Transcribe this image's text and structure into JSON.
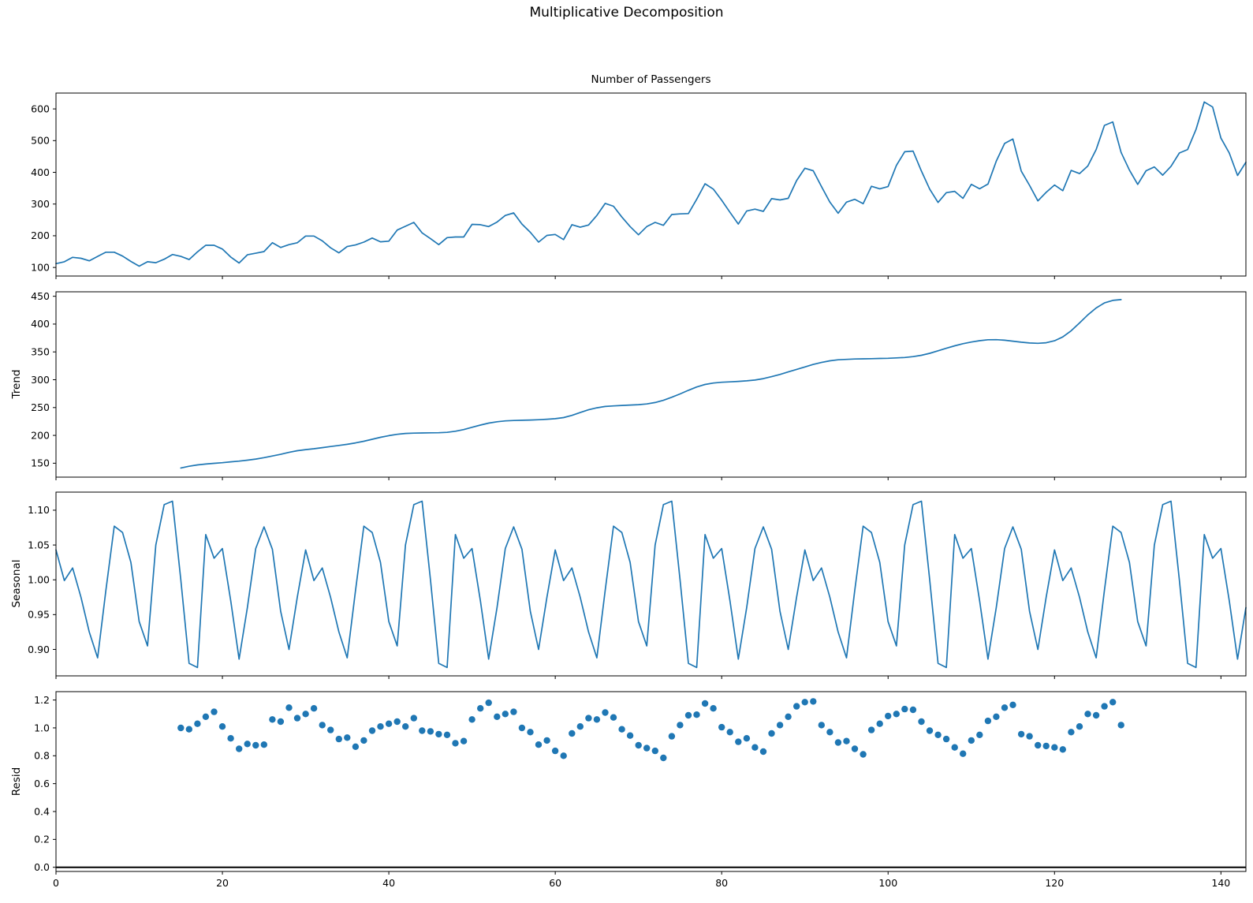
{
  "figure": {
    "suptitle": "Multiplicative Decomposition",
    "background": "#ffffff",
    "series_color": "#1f77b4",
    "axhline_color": "#000000",
    "spine_color": "#000000"
  },
  "chart_data": [
    {
      "type": "line",
      "title": "Number of Passengers",
      "ylabel": "",
      "xlim": [
        0,
        143
      ],
      "ylim": [
        73,
        650
      ],
      "yticks": [
        100,
        200,
        300,
        400,
        500,
        600
      ],
      "ytick_labels": [
        "100",
        "200",
        "300",
        "400",
        "500",
        "600"
      ],
      "x_start": 0,
      "values": [
        112,
        118,
        132,
        129,
        121,
        135,
        148,
        148,
        136,
        119,
        104,
        118,
        115,
        126,
        141,
        135,
        125,
        149,
        170,
        170,
        158,
        133,
        114,
        140,
        145,
        150,
        178,
        163,
        172,
        178,
        199,
        199,
        184,
        162,
        146,
        166,
        171,
        180,
        193,
        181,
        183,
        218,
        230,
        242,
        209,
        191,
        172,
        194,
        196,
        196,
        236,
        235,
        229,
        243,
        264,
        272,
        237,
        211,
        180,
        201,
        204,
        188,
        235,
        227,
        234,
        264,
        302,
        293,
        259,
        229,
        203,
        229,
        242,
        233,
        267,
        269,
        270,
        315,
        364,
        347,
        312,
        274,
        237,
        278,
        284,
        277,
        317,
        313,
        318,
        374,
        413,
        405,
        355,
        306,
        271,
        306,
        315,
        301,
        356,
        348,
        355,
        422,
        465,
        467,
        404,
        347,
        305,
        336,
        340,
        318,
        362,
        348,
        363,
        435,
        491,
        505,
        404,
        359,
        310,
        337,
        360,
        342,
        406,
        396,
        420,
        472,
        548,
        559,
        463,
        407,
        362,
        405,
        417,
        391,
        419,
        461,
        472,
        535,
        622,
        606,
        508,
        461,
        390,
        432
      ]
    },
    {
      "type": "line",
      "title": "",
      "ylabel": "Trend",
      "xlim": [
        0,
        143
      ],
      "ylim": [
        125,
        458
      ],
      "yticks": [
        150,
        200,
        250,
        300,
        350,
        400,
        450
      ],
      "ytick_labels": [
        "150",
        "200",
        "250",
        "300",
        "350",
        "400",
        "450"
      ],
      "x_start": 15,
      "values": [
        141.5,
        144.5,
        147,
        148.5,
        149.8,
        151,
        152.5,
        153.8,
        155.5,
        157.5,
        160,
        163,
        166,
        169.5,
        172.5,
        174.5,
        176,
        178,
        180,
        182,
        184,
        186.5,
        189.5,
        193,
        196.5,
        199.5,
        202,
        203.5,
        204,
        204.3,
        204.6,
        204.8,
        205.5,
        207.5,
        210.5,
        214.5,
        218.5,
        222,
        224.5,
        226,
        226.8,
        227.2,
        227.6,
        228.2,
        229,
        230,
        232,
        236,
        241,
        246,
        249.5,
        252,
        253,
        253.8,
        254.5,
        255.2,
        256.5,
        259,
        263,
        268.5,
        274.5,
        281,
        287,
        291.5,
        294,
        295.5,
        296.2,
        297,
        298,
        299.5,
        302,
        305.5,
        309.5,
        314,
        318.5,
        323,
        327.5,
        331,
        334,
        335.8,
        336.6,
        337.2,
        337.6,
        337.9,
        338.2,
        338.6,
        339.2,
        340,
        341.5,
        344,
        347.5,
        352,
        356.5,
        361,
        364.8,
        367.8,
        370.2,
        371.8,
        372,
        371,
        369.3,
        367.5,
        366,
        365.4,
        366.5,
        370,
        377,
        388,
        402,
        416.5,
        429,
        438,
        442.5,
        444
      ]
    },
    {
      "type": "line",
      "title": "",
      "ylabel": "Seasonal",
      "xlim": [
        0,
        143
      ],
      "ylim": [
        0.862,
        1.126
      ],
      "yticks": [
        0.9,
        0.95,
        1.0,
        1.05,
        1.1
      ],
      "ytick_labels": [
        "0.90",
        "0.95",
        "1.00",
        "1.05",
        "1.10"
      ],
      "x_start": 0,
      "n_points": 144,
      "period": 30,
      "pattern": [
        1.043,
        0.999,
        1.017,
        0.975,
        0.925,
        0.888,
        0.985,
        1.077,
        1.068,
        1.025,
        0.94,
        0.905,
        1.05,
        1.108,
        1.113,
        1.0,
        0.88,
        0.874,
        1.065,
        1.031,
        1.045,
        0.97,
        0.886,
        0.96,
        1.045,
        1.076,
        1.044,
        0.955,
        0.9,
        0.975
      ]
    },
    {
      "type": "scatter",
      "title": "",
      "ylabel": "Resid",
      "xlim": [
        0,
        143
      ],
      "ylim": [
        -0.03,
        1.26
      ],
      "yticks": [
        0.0,
        0.2,
        0.4,
        0.6,
        0.8,
        1.0,
        1.2
      ],
      "ytick_labels": [
        "0.0",
        "0.2",
        "0.4",
        "0.6",
        "0.8",
        "1.0",
        "1.2"
      ],
      "axhline": 0,
      "x_start": 15,
      "values": [
        1.0,
        0.99,
        1.03,
        1.08,
        1.115,
        1.01,
        0.925,
        0.85,
        0.885,
        0.875,
        0.88,
        1.06,
        1.045,
        1.145,
        1.07,
        1.1,
        1.14,
        1.02,
        0.985,
        0.92,
        0.93,
        0.865,
        0.91,
        0.98,
        1.01,
        1.03,
        1.045,
        1.01,
        1.07,
        0.98,
        0.975,
        0.955,
        0.95,
        0.89,
        0.905,
        1.06,
        1.14,
        1.18,
        1.08,
        1.1,
        1.115,
        1.0,
        0.97,
        0.88,
        0.91,
        0.835,
        0.8,
        0.96,
        1.01,
        1.07,
        1.06,
        1.11,
        1.075,
        0.99,
        0.945,
        0.875,
        0.855,
        0.835,
        0.785,
        0.94,
        1.02,
        1.09,
        1.095,
        1.175,
        1.14,
        1.005,
        0.97,
        0.9,
        0.925,
        0.86,
        0.83,
        0.96,
        1.02,
        1.08,
        1.155,
        1.185,
        1.19,
        1.02,
        0.97,
        0.895,
        0.905,
        0.85,
        0.81,
        0.985,
        1.03,
        1.085,
        1.1,
        1.135,
        1.13,
        1.045,
        0.98,
        0.95,
        0.92,
        0.86,
        0.815,
        0.91,
        0.95,
        1.05,
        1.08,
        1.145,
        1.165,
        0.955,
        0.94,
        0.875,
        0.87,
        0.86,
        0.845,
        0.97,
        1.01,
        1.1,
        1.09,
        1.155,
        1.185,
        1.02
      ]
    }
  ],
  "xaxis": {
    "ticks": [
      0,
      20,
      40,
      60,
      80,
      100,
      120,
      140
    ],
    "tick_labels": [
      "0",
      "20",
      "40",
      "60",
      "80",
      "100",
      "120",
      "140"
    ]
  }
}
